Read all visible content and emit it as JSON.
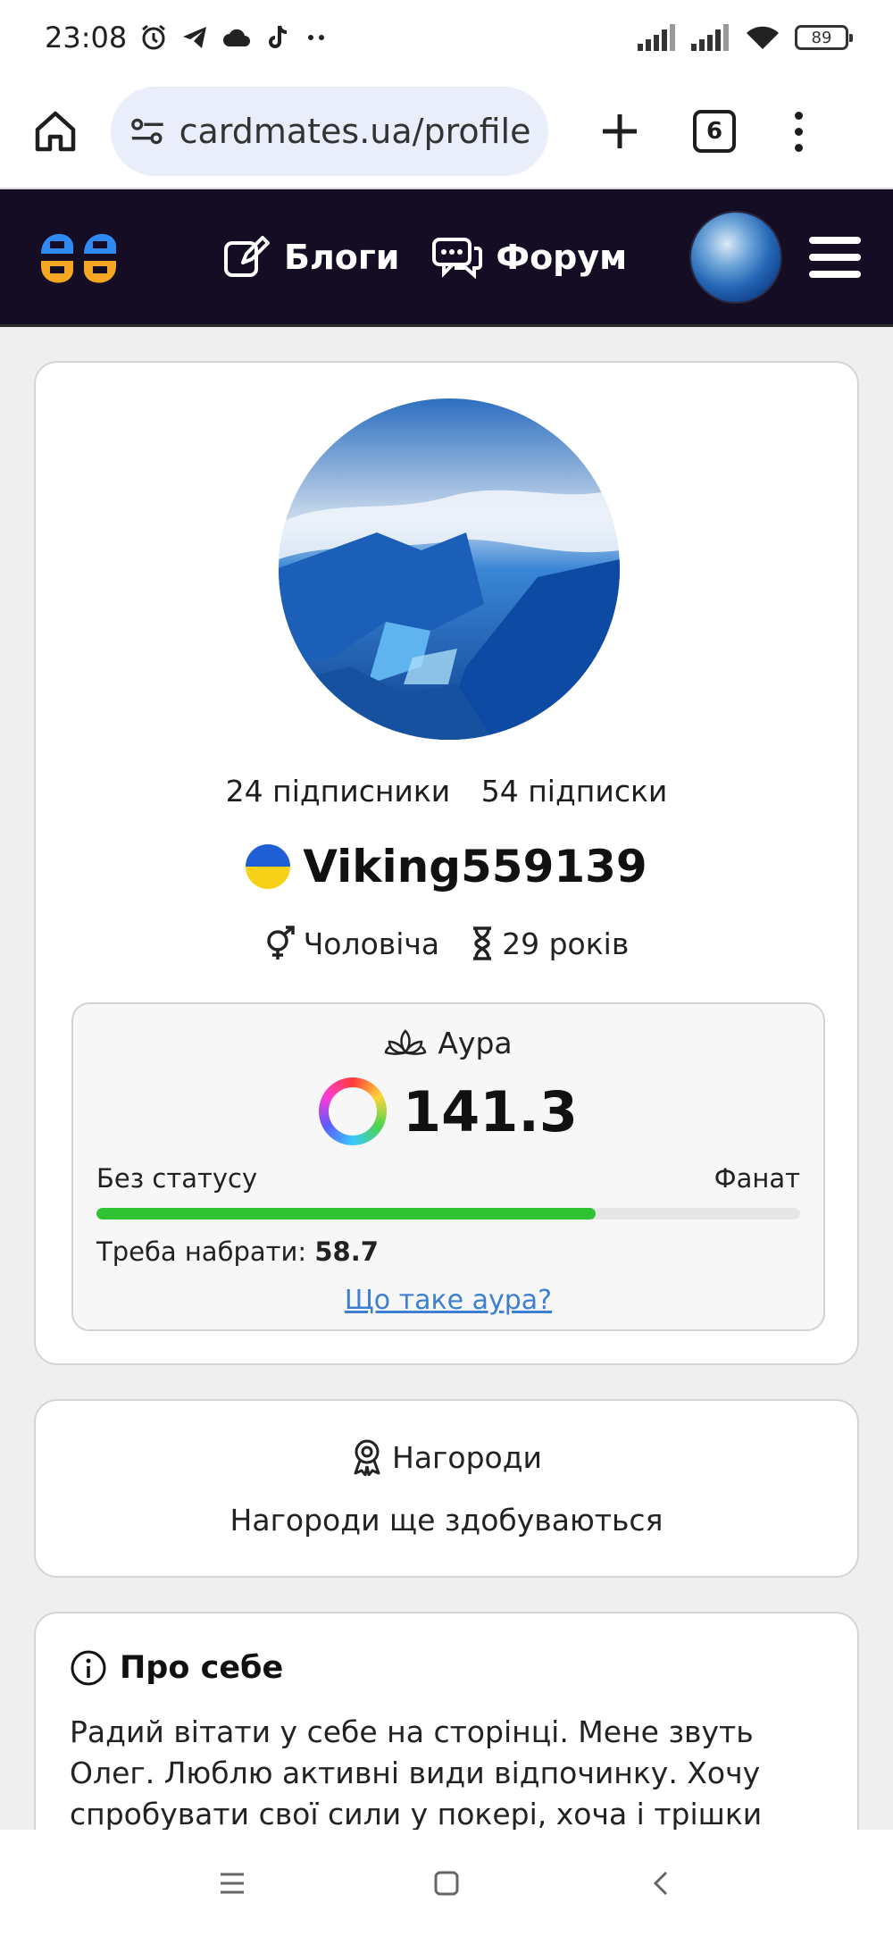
{
  "status_bar": {
    "time": "23:08",
    "battery": "89",
    "icons": [
      "alarm-icon",
      "telegram-icon",
      "cloud-icon",
      "tiktok-icon",
      "more-dots-icon",
      "signal-icon",
      "signal-icon",
      "wifi-icon",
      "battery-icon"
    ]
  },
  "browser": {
    "url": "cardmates.ua/profile/",
    "tab_count": "6"
  },
  "site_header": {
    "nav": [
      {
        "label": "Блоги",
        "icon": "edit-icon"
      },
      {
        "label": "Форум",
        "icon": "chat-icon"
      }
    ]
  },
  "profile": {
    "followers": "24 підписники",
    "following": "54 підписки",
    "username": "Viking559139",
    "gender": "Чоловіча",
    "age": "29 років"
  },
  "aura": {
    "title": "Аура",
    "value": "141.3",
    "status_from": "Без статусу",
    "status_to": "Фанат",
    "progress": 0.71,
    "need_label": "Треба набрати:",
    "need_value": "58.7",
    "link": "Що таке аура?"
  },
  "awards": {
    "title": "Нагороди",
    "text": "Нагороди ще здобуваються"
  },
  "about": {
    "title": "Про себе",
    "text": "Радий вітати у себе на сторінці. Мене звуть Олег. Люблю активні види відпочинку. Хочу спробувати свої сили у покері, хоча і трішки грав"
  },
  "colors": {
    "header_bg": "#140d24",
    "progress": "#2fc232",
    "link": "#3d7fd0",
    "logo_blue": "#2f8bf2",
    "logo_orange": "#f5a623"
  }
}
